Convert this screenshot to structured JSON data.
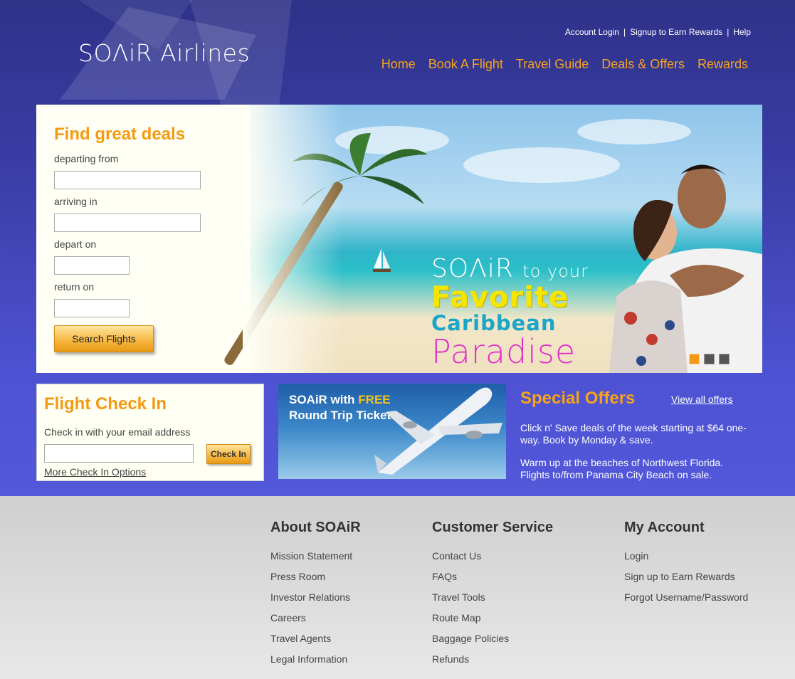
{
  "brand": {
    "logo": "SOΛiR Airlines"
  },
  "util_nav": [
    {
      "label": "Account Login"
    },
    {
      "label": "Signup to Earn Rewards"
    },
    {
      "label": "Help"
    }
  ],
  "main_nav": [
    {
      "label": "Home"
    },
    {
      "label": "Book A Flight"
    },
    {
      "label": "Travel Guide"
    },
    {
      "label": "Deals & Offers"
    },
    {
      "label": "Rewards"
    }
  ],
  "search_form": {
    "title": "Find great deals",
    "departing_label": "departing from",
    "arriving_label": "arriving in",
    "depart_on_label": "depart on",
    "return_on_label": "return on",
    "departing_value": "",
    "arriving_value": "",
    "depart_on_value": "",
    "return_on_value": "",
    "button": "Search Flights"
  },
  "banner": {
    "line1_brand": "SOΛiR",
    "line1_rest": "to your",
    "line2": "Favorite",
    "line3": "Caribbean",
    "line4": "Paradise",
    "slides": 3,
    "active_slide": 1
  },
  "checkin": {
    "title": "Flight Check In",
    "label": "Check in with your email address",
    "email_value": "",
    "button": "Check In",
    "more_link": "More Check In Options"
  },
  "promo_tile": {
    "line1_a": "SOAiR with ",
    "line1_free": "FREE",
    "line2": "Round Trip Tickets"
  },
  "special_offers": {
    "title": "Special Offers",
    "view_all": "View all offers",
    "offers": [
      "Click n' Save deals of the week starting at $64 one-way. Book by Monday & save.",
      "Warm up at the beaches of Northwest Florida. Flights to/from Panama City Beach on sale."
    ]
  },
  "footer": {
    "columns": [
      {
        "heading": "About SOAiR",
        "links": [
          "Mission Statement",
          "Press Room",
          "Investor Relations",
          "Careers",
          "Travel Agents",
          "Legal Information"
        ]
      },
      {
        "heading": "Customer Service",
        "links": [
          "Contact Us",
          "FAQs",
          "Travel Tools",
          "Route Map",
          "Baggage Policies",
          "Refunds"
        ]
      },
      {
        "heading": "My Account",
        "links": [
          "Login",
          "Sign up to Earn Rewards",
          "Forgot Username/Password"
        ]
      }
    ]
  },
  "colors": {
    "accent_orange": "#f39a12",
    "header_blue": "#3a3ea6",
    "footer_gray": "#e0e0e0"
  }
}
